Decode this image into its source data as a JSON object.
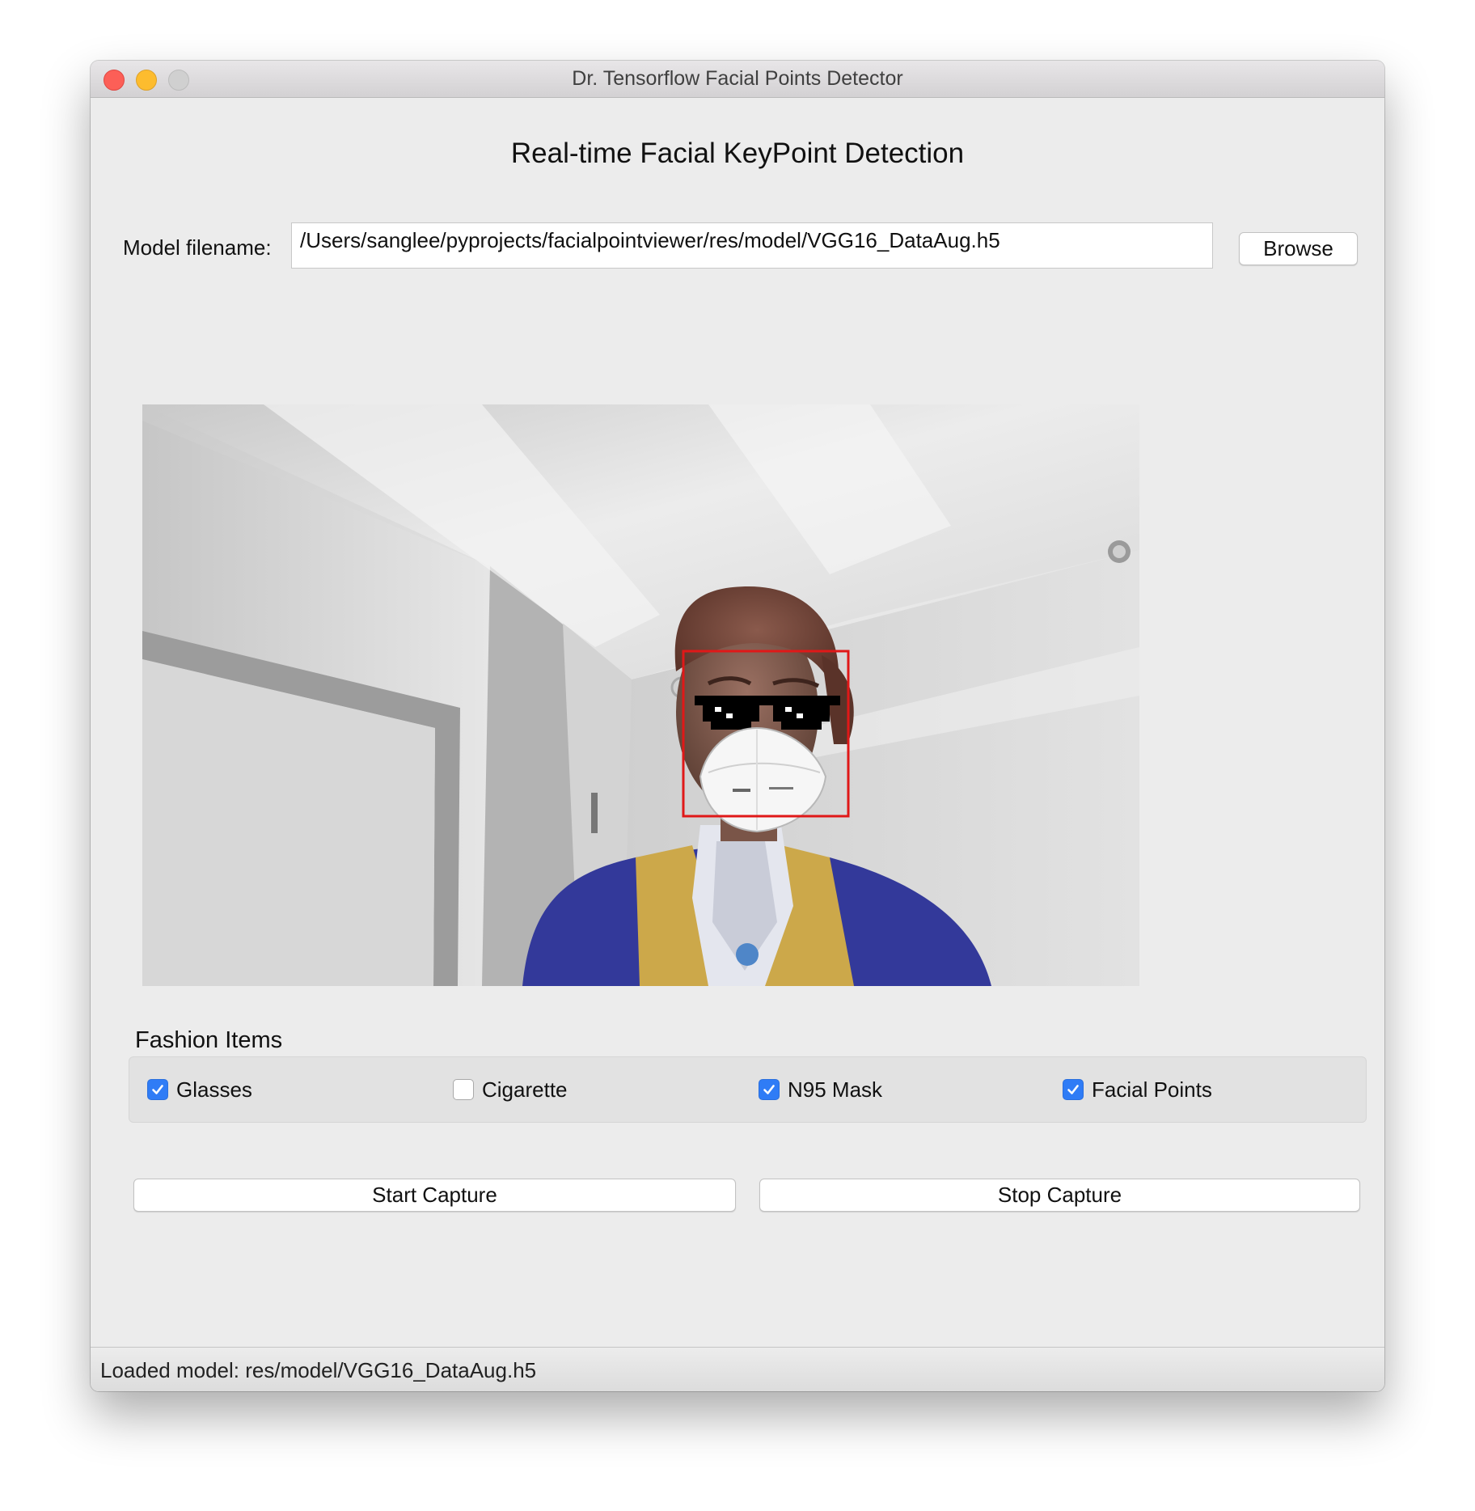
{
  "window": {
    "title": "Dr. Tensorflow Facial Points Detector"
  },
  "header": {
    "heading": "Real-time Facial KeyPoint Detection"
  },
  "model": {
    "label": "Model filename:",
    "path": "/Users/sanglee/pyprojects/facialpointviewer/res/model/VGG16_DataAug.h5",
    "browse_label": "Browse"
  },
  "video": {
    "icon": "webcam-frame-image",
    "detection_box_color": "#e01818"
  },
  "fashion": {
    "title": "Fashion Items",
    "items": [
      {
        "label": "Glasses",
        "checked": true
      },
      {
        "label": "Cigarette",
        "checked": false
      },
      {
        "label": "N95 Mask",
        "checked": true
      },
      {
        "label": "Facial Points",
        "checked": true
      }
    ]
  },
  "actions": {
    "start_label": "Start Capture",
    "stop_label": "Stop Capture"
  },
  "status": {
    "text": "Loaded model: res/model/VGG16_DataAug.h5"
  },
  "colors": {
    "accent": "#2f7cf6",
    "window_bg": "#ececec"
  }
}
